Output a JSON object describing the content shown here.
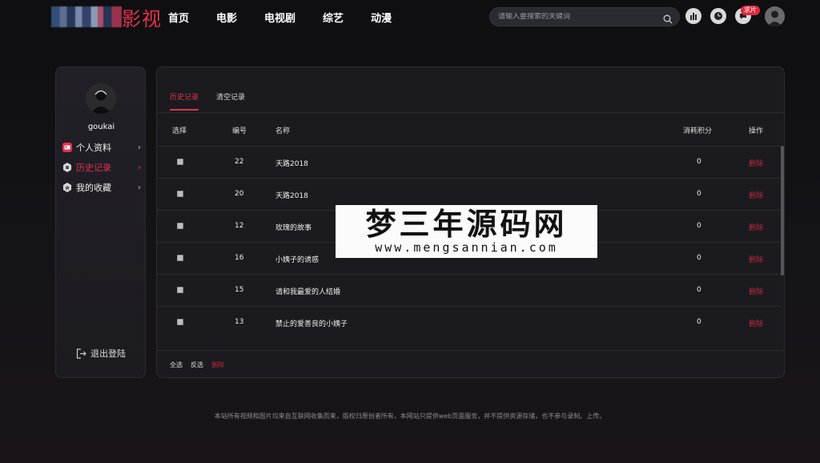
{
  "header": {
    "logo_text": "影视",
    "nav": [
      "首页",
      "电影",
      "电视剧",
      "综艺",
      "动漫"
    ],
    "search_placeholder": "请输入要搜索的关键词",
    "badge": "求片"
  },
  "sidebar": {
    "username": "goukai",
    "items": [
      {
        "label": "个人资料",
        "icon": "id-card-icon"
      },
      {
        "label": "历史记录",
        "icon": "history-hex-icon"
      },
      {
        "label": "我的收藏",
        "icon": "star-hex-icon"
      }
    ],
    "logout": "退出登陆"
  },
  "panel": {
    "tabs": [
      "历史记录",
      "清空记录"
    ],
    "columns": {
      "select": "选择",
      "id": "编号",
      "name": "名称",
      "points": "消耗积分",
      "action": "操作"
    },
    "rows": [
      {
        "id": "22",
        "name": "天路2018",
        "points": "0",
        "action": "删除"
      },
      {
        "id": "20",
        "name": "天路2018",
        "points": "0",
        "action": "删除"
      },
      {
        "id": "12",
        "name": "玫瑰的故事",
        "points": "0",
        "action": "删除"
      },
      {
        "id": "16",
        "name": "小姨子的诱惑",
        "points": "0",
        "action": "删除"
      },
      {
        "id": "15",
        "name": "请和我最爱的人结婚",
        "points": "0",
        "action": "删除"
      },
      {
        "id": "13",
        "name": "禁止的爱善良的小姨子",
        "points": "0",
        "action": "删除"
      }
    ],
    "footer": {
      "select_all": "全选",
      "invert": "反选",
      "delete": "删除"
    }
  },
  "copyright": "本站所有视频和图片均来自互联网收集而来，版权归原创者所有，本网站只提供web页面服务，并不提供资源存储，也不参与录制、上传。",
  "watermark": {
    "title": "梦三年源码网",
    "url": "www.mengsannian.com"
  },
  "colors": {
    "accent": "#e2324a",
    "background": "#141418",
    "panel": "#1b1b1f"
  }
}
